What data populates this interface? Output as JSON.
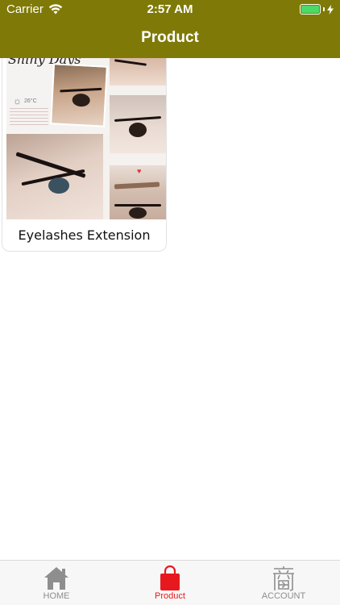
{
  "status_bar": {
    "carrier": "Carrier",
    "time": "2:57 AM"
  },
  "nav": {
    "title": "Product"
  },
  "products": [
    {
      "name": "Eyelashes Extension",
      "image_script_text": "Shiny Days",
      "image_temp_text": "26°C"
    }
  ],
  "tabbar": {
    "items": [
      {
        "label": "HOME",
        "icon": "home-icon",
        "active": false
      },
      {
        "label": "Product",
        "icon": "shopping-bag-icon",
        "active": true
      },
      {
        "label": "ACCOUNT",
        "icon": "account-kanji-icon",
        "active": false
      }
    ]
  },
  "colors": {
    "header": "#7f7a08",
    "active_tab": "#e8191e",
    "inactive_tab": "#8e8e8e",
    "battery": "#4cd964"
  }
}
